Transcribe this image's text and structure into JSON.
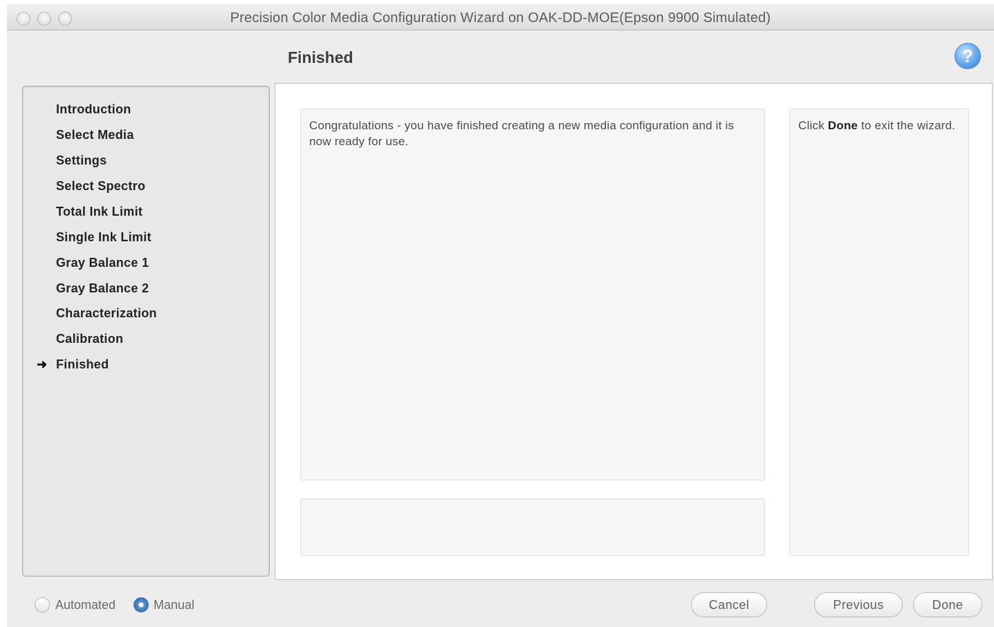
{
  "window": {
    "title": "Precision Color Media Configuration Wizard on OAK-DD-MOE(Epson 9900 Simulated)"
  },
  "header": {
    "title": "Finished",
    "help_label": "?"
  },
  "sidebar": {
    "current_marker": "➜",
    "steps": [
      "Introduction",
      "Select Media",
      "Settings",
      "Select Spectro",
      "Total Ink Limit",
      "Single Ink Limit",
      "Gray Balance 1",
      "Gray Balance 2",
      "Characterization",
      "Calibration",
      "Finished"
    ]
  },
  "main": {
    "message": "Congratulations - you have finished creating a new media configuration and it is now ready for use.",
    "hint_prefix": "Click ",
    "hint_bold": "Done",
    "hint_suffix": " to exit the wizard."
  },
  "footer": {
    "mode_automated": "Automated",
    "mode_manual": "Manual",
    "selected_mode": "Manual",
    "cancel": "Cancel",
    "previous": "Previous",
    "done": "Done"
  }
}
